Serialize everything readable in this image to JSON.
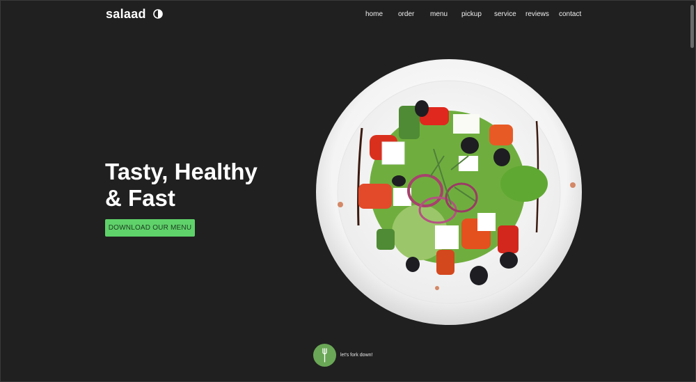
{
  "brand": {
    "name": "salaad",
    "toggle_icon": "half-circle-contrast-icon"
  },
  "nav": {
    "items": [
      {
        "label": "home"
      },
      {
        "label": "order"
      },
      {
        "label": "menu"
      },
      {
        "label": "pickup"
      },
      {
        "label": "service"
      },
      {
        "label": "reviews"
      },
      {
        "label": "contact"
      }
    ]
  },
  "hero": {
    "title_line1": "Tasty, Healthy",
    "title_line2": "& Fast",
    "cta_label": "DOWNLOAD OUR MENU",
    "image_label": "salad-plate"
  },
  "scroll": {
    "icon": "fork-icon",
    "label": "let's fork down!"
  },
  "colors": {
    "background": "#202020",
    "accent": "#5fd26a",
    "fork_button": "#6aa756"
  }
}
